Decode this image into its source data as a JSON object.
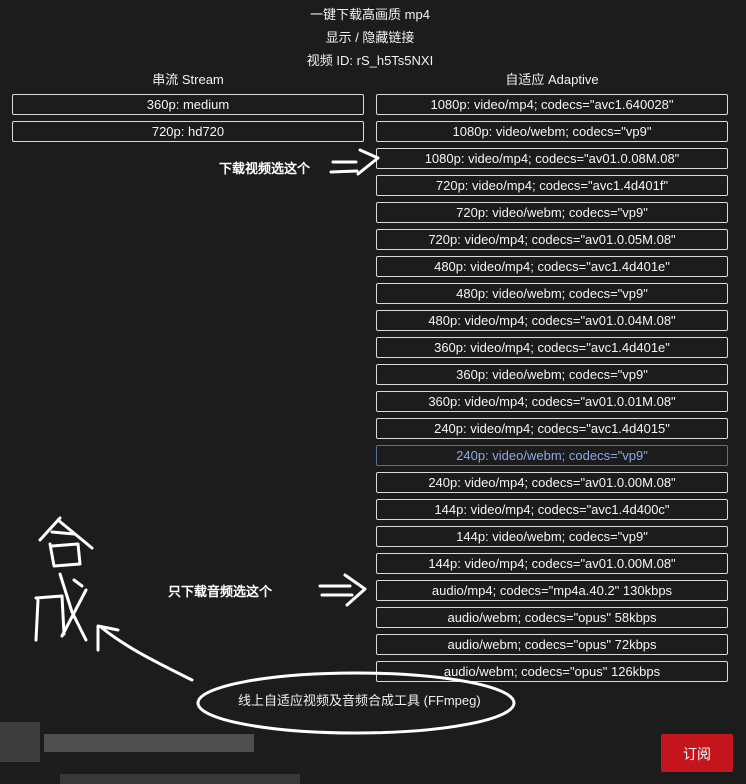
{
  "header": {
    "title": "一键下载高画质 mp4",
    "toggle_links": "显示 / 隐藏链接",
    "video_id": "视频 ID: rS_h5Ts5NXI"
  },
  "stream": {
    "heading": "串流 Stream",
    "items": [
      {
        "label": "360p: medium"
      },
      {
        "label": "720p: hd720"
      }
    ]
  },
  "adaptive": {
    "heading": "自适应 Adaptive",
    "items": [
      {
        "label": "1080p: video/mp4; codecs=\"avc1.640028\""
      },
      {
        "label": "1080p: video/webm; codecs=\"vp9\""
      },
      {
        "label": "1080p: video/mp4; codecs=\"av01.0.08M.08\""
      },
      {
        "label": "720p: video/mp4; codecs=\"avc1.4d401f\""
      },
      {
        "label": "720p: video/webm; codecs=\"vp9\""
      },
      {
        "label": "720p: video/mp4; codecs=\"av01.0.05M.08\""
      },
      {
        "label": "480p: video/mp4; codecs=\"avc1.4d401e\""
      },
      {
        "label": "480p: video/webm; codecs=\"vp9\""
      },
      {
        "label": "480p: video/mp4; codecs=\"av01.0.04M.08\""
      },
      {
        "label": "360p: video/mp4; codecs=\"avc1.4d401e\""
      },
      {
        "label": "360p: video/webm; codecs=\"vp9\""
      },
      {
        "label": "360p: video/mp4; codecs=\"av01.0.01M.08\""
      },
      {
        "label": "240p: video/mp4; codecs=\"avc1.4d4015\""
      },
      {
        "label": "240p: video/webm; codecs=\"vp9\""
      },
      {
        "label": "240p: video/mp4; codecs=\"av01.0.00M.08\""
      },
      {
        "label": "144p: video/mp4; codecs=\"avc1.4d400c\""
      },
      {
        "label": "144p: video/webm; codecs=\"vp9\""
      },
      {
        "label": "144p: video/mp4; codecs=\"av01.0.00M.08\""
      },
      {
        "label": "audio/mp4; codecs=\"mp4a.40.2\" 130kbps"
      },
      {
        "label": "audio/webm; codecs=\"opus\" 58kbps"
      },
      {
        "label": "audio/webm; codecs=\"opus\" 72kbps"
      },
      {
        "label": "audio/webm; codecs=\"opus\" 126kbps"
      }
    ],
    "active_index": 13
  },
  "annotations": {
    "video_hint": "下载视频选这个",
    "audio_hint": "只下载音频选这个",
    "handwritten": "合成"
  },
  "tool_link": "线上自适应视频及音频合成工具 (FFmpeg)",
  "subscribe_label": "订阅",
  "colors": {
    "background": "#1c1c1c",
    "border": "#d9d9d9",
    "active_text": "#8fa8e6",
    "subscribe": "#c4151c"
  }
}
